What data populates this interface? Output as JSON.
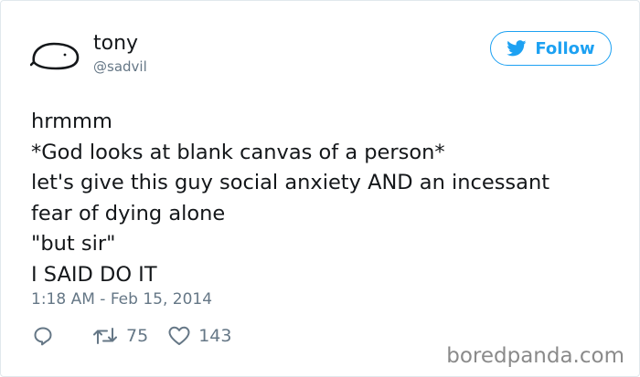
{
  "user": {
    "name": "tony",
    "handle": "@sadvil"
  },
  "follow_button": {
    "label": "Follow"
  },
  "tweet": {
    "lines": [
      "hrmmm",
      "*God looks at blank canvas of a person*",
      "let's give this guy social anxiety AND an incessant",
      "fear of dying alone",
      "\"but sir\"",
      "I SAID DO IT"
    ],
    "timestamp": "1:18 AM - Feb 15, 2014"
  },
  "actions": {
    "retweet_count": "75",
    "like_count": "143"
  },
  "watermark": "boredpanda.com",
  "colors": {
    "accent": "#1da1f2",
    "text": "#14171a",
    "muted": "#657786"
  },
  "icons": [
    "avatar-doodle",
    "twitter-bird-icon",
    "reply-icon",
    "retweet-icon",
    "heart-icon"
  ]
}
